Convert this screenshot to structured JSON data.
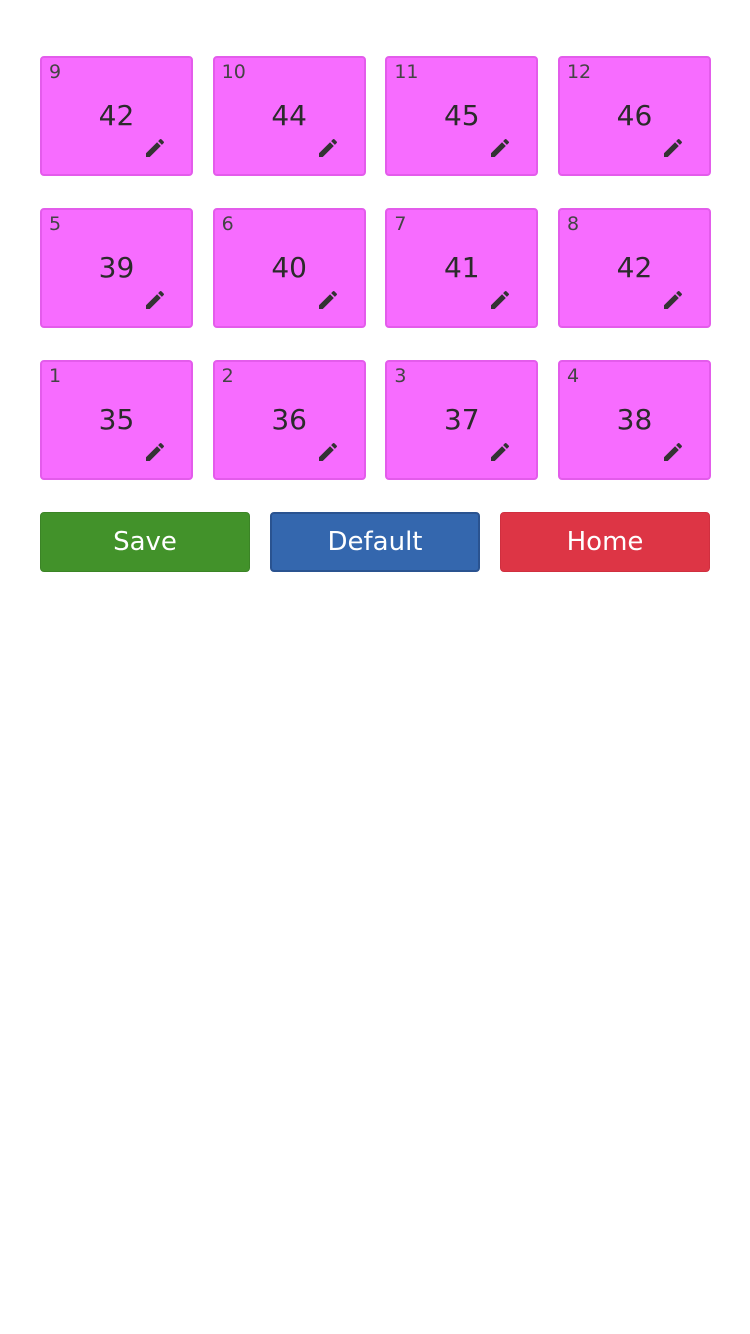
{
  "tiles": [
    {
      "index": "9",
      "value": "42"
    },
    {
      "index": "10",
      "value": "44"
    },
    {
      "index": "11",
      "value": "45"
    },
    {
      "index": "12",
      "value": "46"
    },
    {
      "index": "5",
      "value": "39"
    },
    {
      "index": "6",
      "value": "40"
    },
    {
      "index": "7",
      "value": "41"
    },
    {
      "index": "8",
      "value": "42"
    },
    {
      "index": "1",
      "value": "35"
    },
    {
      "index": "2",
      "value": "36"
    },
    {
      "index": "3",
      "value": "37"
    },
    {
      "index": "4",
      "value": "38"
    }
  ],
  "tile_icon": "pencil-icon",
  "colors": {
    "tile_fill": "#f76cff",
    "tile_border": "#e35ceb",
    "save": "#42922a",
    "default": "#3467ae",
    "home": "#dd3545"
  },
  "buttons": {
    "save_label": "Save",
    "default_label": "Default",
    "home_label": "Home"
  }
}
